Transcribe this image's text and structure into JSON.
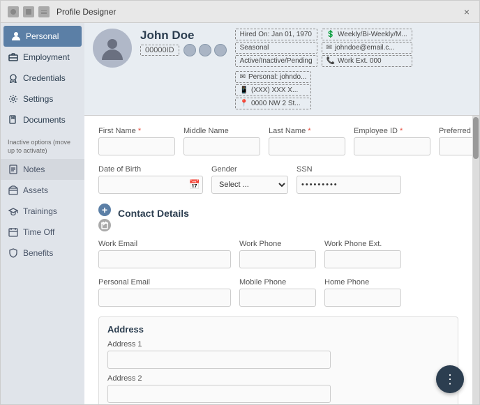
{
  "titleBar": {
    "title": "Profile Designer",
    "closeLabel": "×"
  },
  "sidebar": {
    "activeItems": [
      {
        "id": "personal",
        "label": "Personal",
        "icon": "person"
      },
      {
        "id": "employment",
        "label": "Employment",
        "icon": "briefcase"
      },
      {
        "id": "credentials",
        "label": "Credentials",
        "icon": "award"
      },
      {
        "id": "settings",
        "label": "Settings",
        "icon": "gear"
      },
      {
        "id": "documents",
        "label": "Documents",
        "icon": "doc"
      }
    ],
    "inactiveLabel": "Inactive options (move up to activate)",
    "inactiveItems": [
      {
        "id": "notes",
        "label": "Notes",
        "icon": "note"
      },
      {
        "id": "assets",
        "label": "Assets",
        "icon": "box"
      },
      {
        "id": "trainings",
        "label": "Trainings",
        "icon": "hat"
      },
      {
        "id": "timeoff",
        "label": "Time Off",
        "icon": "calendar"
      },
      {
        "id": "benefits",
        "label": "Benefits",
        "icon": "shield"
      }
    ]
  },
  "profile": {
    "name": "John Doe",
    "idBadge": "00000ID",
    "badges": {
      "col1": [
        "Hired On: Jan 01, 1970",
        "Seasonal",
        "Active/Inactive/Pending"
      ],
      "col2": [
        "Weekly/Bi-Weekly/M...",
        "johndoe@email.c...",
        "Work Ext. 000"
      ],
      "col3": [
        "Personal: johndo...",
        "(XXX) XXX X...",
        "0000 NW 2 St..."
      ]
    }
  },
  "form": {
    "fields": {
      "firstName": {
        "label": "First Name",
        "required": true,
        "value": ""
      },
      "middleName": {
        "label": "Middle Name",
        "required": false,
        "value": ""
      },
      "lastName": {
        "label": "Last Name",
        "required": true,
        "value": ""
      },
      "employeeId": {
        "label": "Employee ID",
        "required": true,
        "value": ""
      },
      "preferredName": {
        "label": "Preferred Name",
        "required": false,
        "value": ""
      },
      "dateOfBirth": {
        "label": "Date of Birth",
        "value": ""
      },
      "gender": {
        "label": "Gender",
        "placeholder": "Select ...",
        "value": ""
      },
      "ssn": {
        "label": "SSN",
        "value": "•••••••••"
      }
    },
    "contactDetails": {
      "sectionTitle": "Contact Details",
      "addButton": "+",
      "removeButton": "🗑",
      "workEmail": {
        "label": "Work Email",
        "value": ""
      },
      "workPhone": {
        "label": "Work Phone",
        "value": ""
      },
      "workPhoneExt": {
        "label": "Work Phone Ext.",
        "value": ""
      },
      "personalEmail": {
        "label": "Personal Email",
        "value": ""
      },
      "mobilePhone": {
        "label": "Mobile Phone",
        "value": ""
      },
      "homePhone": {
        "label": "Home Phone",
        "value": ""
      }
    },
    "address": {
      "sectionTitle": "Address",
      "address1Label": "Address 1",
      "address1Value": "",
      "address2Label": "Address 2",
      "address2Value": ""
    }
  },
  "fab": {
    "label": "⋮"
  }
}
